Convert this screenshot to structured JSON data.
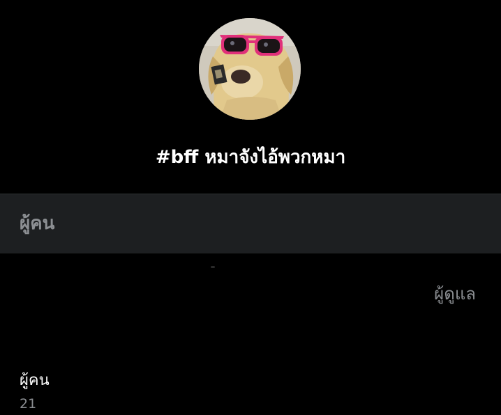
{
  "group": {
    "avatar_icon": "dog-with-sunglasses-avatar",
    "title": "#bff หมาจังไอ้พวกหมา"
  },
  "section": {
    "header_label": "ผู้คน"
  },
  "admin": {
    "label": "ผู้ดูแล"
  },
  "people": {
    "label": "ผู้คน",
    "count": "21"
  },
  "colors": {
    "background": "#000000",
    "section_header_bg": "#1d1f21",
    "muted_text": "#8a8d91",
    "sunglasses_frame": "#e0307a"
  }
}
